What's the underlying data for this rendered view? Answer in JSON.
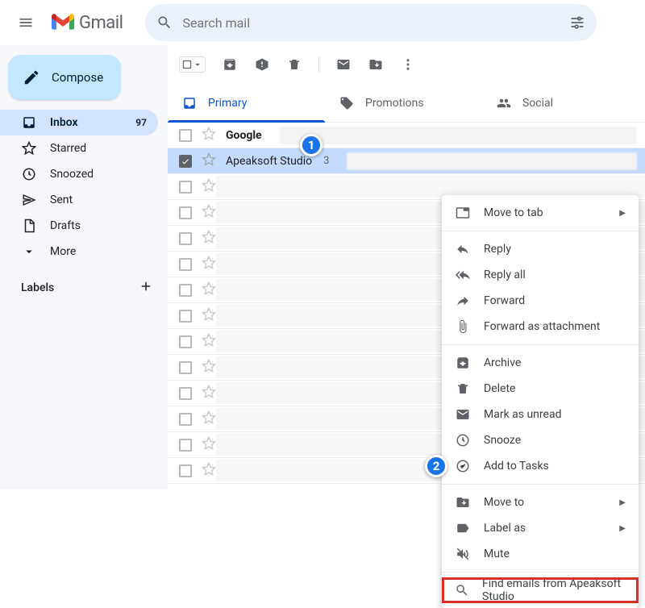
{
  "header": {
    "brand": "Gmail",
    "search_placeholder": "Search mail"
  },
  "sidebar": {
    "compose": "Compose",
    "items": [
      {
        "label": "Inbox",
        "count": "97",
        "active": true
      },
      {
        "label": "Starred"
      },
      {
        "label": "Snoozed"
      },
      {
        "label": "Sent"
      },
      {
        "label": "Drafts"
      },
      {
        "label": "More"
      }
    ],
    "labels_header": "Labels"
  },
  "tabs": {
    "primary": "Primary",
    "promotions": "Promotions",
    "social": "Social"
  },
  "rows": [
    {
      "sender": "Google",
      "bold": true,
      "selected": false
    },
    {
      "sender": "Apeaksoft Studio",
      "count": "3",
      "bold": false,
      "selected": true
    }
  ],
  "context_menu": {
    "move_to_tab": "Move to tab",
    "reply": "Reply",
    "reply_all": "Reply all",
    "forward": "Forward",
    "forward_attachment": "Forward as attachment",
    "archive": "Archive",
    "delete": "Delete",
    "mark_unread": "Mark as unread",
    "snooze": "Snooze",
    "add_tasks": "Add to Tasks",
    "move_to": "Move to",
    "label_as": "Label as",
    "mute": "Mute",
    "find_from": "Find emails from Apeaksoft Studio"
  },
  "callouts": {
    "one": "1",
    "two": "2"
  }
}
